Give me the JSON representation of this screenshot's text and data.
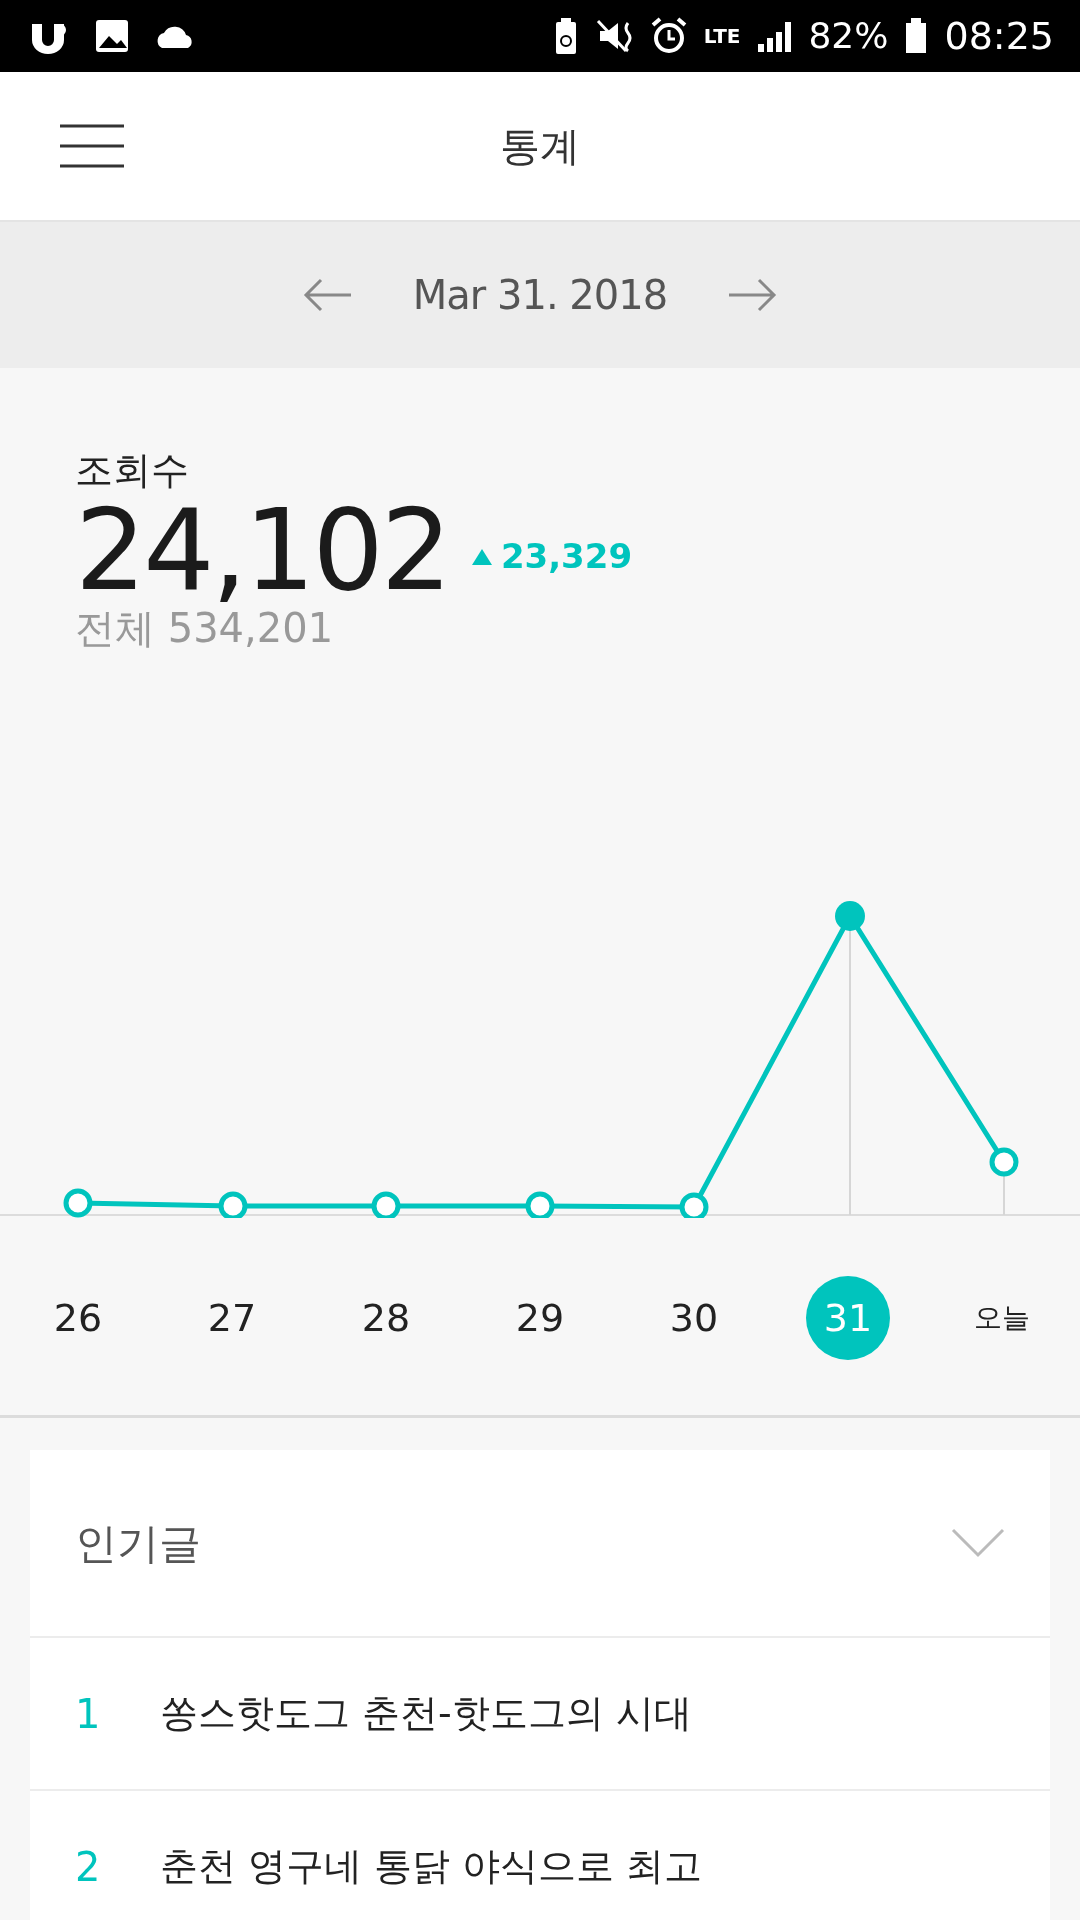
{
  "status_bar": {
    "network": "LTE",
    "battery": "82%",
    "time": "08:25"
  },
  "header": {
    "title": "통계"
  },
  "date_nav": {
    "date": "Mar 31. 2018"
  },
  "stats": {
    "label": "조회수",
    "value": "24,102",
    "change": "23,329",
    "total": "전체 534,201"
  },
  "days": [
    {
      "label": "26",
      "selected": false
    },
    {
      "label": "27",
      "selected": false
    },
    {
      "label": "28",
      "selected": false
    },
    {
      "label": "29",
      "selected": false
    },
    {
      "label": "30",
      "selected": false
    },
    {
      "label": "31",
      "selected": true
    },
    {
      "label": "오늘",
      "selected": false
    }
  ],
  "popular": {
    "title": "인기글",
    "expanded": false,
    "items": [
      {
        "rank": "1",
        "title": "쏭스핫도그 춘천-핫도그의 시대"
      },
      {
        "rank": "2",
        "title": "춘천 영구네 통닭 야식으로 최고"
      }
    ]
  }
}
